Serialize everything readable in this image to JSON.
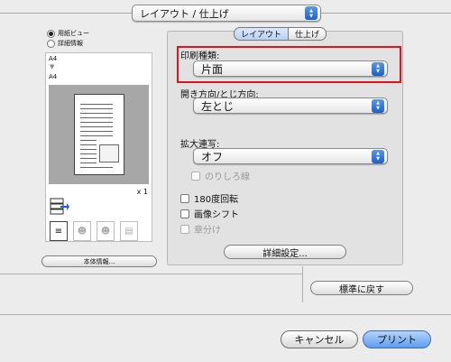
{
  "panel_selector": {
    "value": "レイアウト / 仕上げ"
  },
  "preview": {
    "radio_paper_view": "用紙ビュー",
    "radio_machine_view": "詳細情報",
    "paper_size_top": "A4",
    "paper_size_bottom": "A4",
    "copies": "x 1",
    "machine_info_button": "本体情報..."
  },
  "tabs": [
    {
      "label": "レイアウト",
      "active": true
    },
    {
      "label": "仕上げ",
      "active": false
    }
  ],
  "print_type": {
    "label": "印刷種類:",
    "value": "片面"
  },
  "binding": {
    "label": "開き方向/とじ方向:",
    "value": "左とじ"
  },
  "enlarge": {
    "label": "拡大連写:",
    "value": "オフ"
  },
  "options": {
    "margin_line": "のりしろ線",
    "rotate_180": "180度回転",
    "image_shift": "画像シフト",
    "chapter": "章分け"
  },
  "detail_settings_button": "詳細設定...",
  "restore_defaults_button": "標準に戻す",
  "cancel_button": "キャンセル",
  "print_button": "プリント",
  "colors": {
    "highlight": "#e2131b",
    "primary": "#5e9ef0"
  }
}
